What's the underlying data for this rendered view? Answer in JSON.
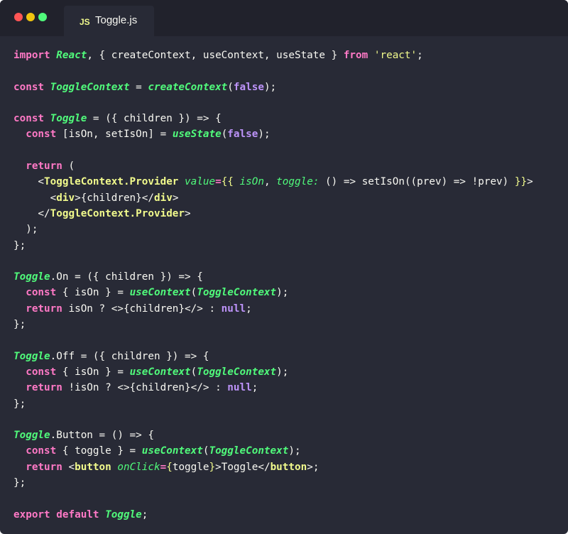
{
  "window": {
    "tab_icon": "JS",
    "tab_title": "Toggle.js"
  },
  "editor": {
    "lines": [
      [
        {
          "t": "import ",
          "c": "keyword"
        },
        {
          "t": "React",
          "c": "class"
        },
        {
          "t": ", { createContext, useContext, useState } ",
          "c": "plain"
        },
        {
          "t": "from ",
          "c": "keyword"
        },
        {
          "t": "'react'",
          "c": "string"
        },
        {
          "t": ";",
          "c": "plain"
        }
      ],
      [],
      [
        {
          "t": "const ",
          "c": "keyword"
        },
        {
          "t": "ToggleContext",
          "c": "class"
        },
        {
          "t": " = ",
          "c": "plain"
        },
        {
          "t": "createContext",
          "c": "func"
        },
        {
          "t": "(",
          "c": "plain"
        },
        {
          "t": "false",
          "c": "const"
        },
        {
          "t": ");",
          "c": "plain"
        }
      ],
      [],
      [
        {
          "t": "const ",
          "c": "keyword"
        },
        {
          "t": "Toggle",
          "c": "class"
        },
        {
          "t": " = ({ children }) => {",
          "c": "plain"
        }
      ],
      [
        {
          "t": "  ",
          "c": "plain"
        },
        {
          "t": "const ",
          "c": "keyword"
        },
        {
          "t": "[isOn, setIsOn] = ",
          "c": "plain"
        },
        {
          "t": "useState",
          "c": "func"
        },
        {
          "t": "(",
          "c": "plain"
        },
        {
          "t": "false",
          "c": "const"
        },
        {
          "t": ");",
          "c": "plain"
        }
      ],
      [],
      [
        {
          "t": "  ",
          "c": "plain"
        },
        {
          "t": "return ",
          "c": "keyword"
        },
        {
          "t": "(",
          "c": "plain"
        }
      ],
      [
        {
          "t": "    <",
          "c": "plain"
        },
        {
          "t": "ToggleContext.Provider",
          "c": "tag"
        },
        {
          "t": " ",
          "c": "plain"
        },
        {
          "t": "value",
          "c": "attr"
        },
        {
          "t": "=",
          "c": "keyword"
        },
        {
          "t": "{{ ",
          "c": "brace"
        },
        {
          "t": "isOn",
          "c": "attr"
        },
        {
          "t": ", ",
          "c": "plain"
        },
        {
          "t": "toggle:",
          "c": "attr"
        },
        {
          "t": " () => setIsOn((prev) => !prev) ",
          "c": "plain"
        },
        {
          "t": "}}",
          "c": "brace"
        },
        {
          "t": ">",
          "c": "plain"
        }
      ],
      [
        {
          "t": "      <",
          "c": "plain"
        },
        {
          "t": "div",
          "c": "tag"
        },
        {
          "t": ">{children}</",
          "c": "plain"
        },
        {
          "t": "div",
          "c": "tag"
        },
        {
          "t": ">",
          "c": "plain"
        }
      ],
      [
        {
          "t": "    </",
          "c": "plain"
        },
        {
          "t": "ToggleContext.Provider",
          "c": "tag"
        },
        {
          "t": ">",
          "c": "plain"
        }
      ],
      [
        {
          "t": "  );",
          "c": "plain"
        }
      ],
      [
        {
          "t": "};",
          "c": "plain"
        }
      ],
      [],
      [
        {
          "t": "Toggle",
          "c": "class"
        },
        {
          "t": ".On = ({ children }) => {",
          "c": "plain"
        }
      ],
      [
        {
          "t": "  ",
          "c": "plain"
        },
        {
          "t": "const ",
          "c": "keyword"
        },
        {
          "t": "{ isOn } = ",
          "c": "plain"
        },
        {
          "t": "useContext",
          "c": "func"
        },
        {
          "t": "(",
          "c": "plain"
        },
        {
          "t": "ToggleContext",
          "c": "class"
        },
        {
          "t": ");",
          "c": "plain"
        }
      ],
      [
        {
          "t": "  ",
          "c": "plain"
        },
        {
          "t": "return ",
          "c": "keyword"
        },
        {
          "t": "isOn ? <>{children}</> : ",
          "c": "plain"
        },
        {
          "t": "null",
          "c": "const"
        },
        {
          "t": ";",
          "c": "plain"
        }
      ],
      [
        {
          "t": "};",
          "c": "plain"
        }
      ],
      [],
      [
        {
          "t": "Toggle",
          "c": "class"
        },
        {
          "t": ".Off = ({ children }) => {",
          "c": "plain"
        }
      ],
      [
        {
          "t": "  ",
          "c": "plain"
        },
        {
          "t": "const ",
          "c": "keyword"
        },
        {
          "t": "{ isOn } = ",
          "c": "plain"
        },
        {
          "t": "useContext",
          "c": "func"
        },
        {
          "t": "(",
          "c": "plain"
        },
        {
          "t": "ToggleContext",
          "c": "class"
        },
        {
          "t": ");",
          "c": "plain"
        }
      ],
      [
        {
          "t": "  ",
          "c": "plain"
        },
        {
          "t": "return ",
          "c": "keyword"
        },
        {
          "t": "!isOn ? <>{children}</> : ",
          "c": "plain"
        },
        {
          "t": "null",
          "c": "const"
        },
        {
          "t": ";",
          "c": "plain"
        }
      ],
      [
        {
          "t": "};",
          "c": "plain"
        }
      ],
      [],
      [
        {
          "t": "Toggle",
          "c": "class"
        },
        {
          "t": ".Button = () => {",
          "c": "plain"
        }
      ],
      [
        {
          "t": "  ",
          "c": "plain"
        },
        {
          "t": "const ",
          "c": "keyword"
        },
        {
          "t": "{ toggle } = ",
          "c": "plain"
        },
        {
          "t": "useContext",
          "c": "func"
        },
        {
          "t": "(",
          "c": "plain"
        },
        {
          "t": "ToggleContext",
          "c": "class"
        },
        {
          "t": ");",
          "c": "plain"
        }
      ],
      [
        {
          "t": "  ",
          "c": "plain"
        },
        {
          "t": "return ",
          "c": "keyword"
        },
        {
          "t": "<",
          "c": "plain"
        },
        {
          "t": "button",
          "c": "tag"
        },
        {
          "t": " ",
          "c": "plain"
        },
        {
          "t": "onClick",
          "c": "attr"
        },
        {
          "t": "=",
          "c": "keyword"
        },
        {
          "t": "{",
          "c": "brace"
        },
        {
          "t": "toggle",
          "c": "plain"
        },
        {
          "t": "}",
          "c": "brace"
        },
        {
          "t": ">Toggle</",
          "c": "plain"
        },
        {
          "t": "button",
          "c": "tag"
        },
        {
          "t": ">;",
          "c": "plain"
        }
      ],
      [
        {
          "t": "};",
          "c": "plain"
        }
      ],
      [],
      [
        {
          "t": "export ",
          "c": "keyword"
        },
        {
          "t": "default ",
          "c": "keyword"
        },
        {
          "t": "Toggle",
          "c": "class"
        },
        {
          "t": ";",
          "c": "plain"
        }
      ]
    ]
  }
}
